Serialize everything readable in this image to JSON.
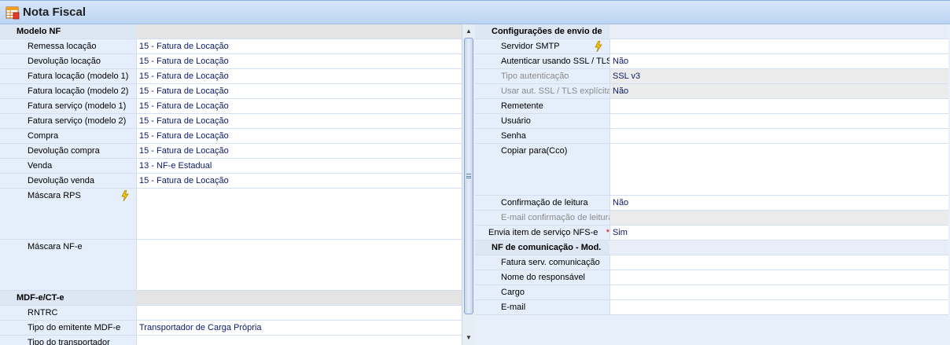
{
  "window": {
    "title": "Nota Fiscal",
    "icon": "table-form-icon"
  },
  "left": {
    "sections": {
      "modelo": {
        "title": "Modelo NF",
        "rows": [
          {
            "label": "Remessa locação",
            "value": "15 - Fatura de Locação"
          },
          {
            "label": "Devolução locação",
            "value": "15 - Fatura de Locação"
          },
          {
            "label": "Fatura locação (modelo 1)",
            "value": "15 - Fatura de Locação"
          },
          {
            "label": "Fatura locação (modelo 2)",
            "value": "15 - Fatura de Locação"
          },
          {
            "label": "Fatura serviço (modelo 1)",
            "value": "15 - Fatura de Locação"
          },
          {
            "label": "Fatura serviço (modelo 2)",
            "value": "15 - Fatura de Locação"
          },
          {
            "label": "Compra",
            "value": "15 - Fatura de Locação"
          },
          {
            "label": "Devolução compra",
            "value": "15 - Fatura de Locação"
          },
          {
            "label": "Venda",
            "value": "13 - NF-e Estadual"
          },
          {
            "label": "Devolução venda",
            "value": "15 - Fatura de Locação"
          }
        ],
        "mascara_rps": {
          "label": "Máscara RPS",
          "value": ""
        },
        "mascara_nfe": {
          "label": "Máscara NF-e",
          "value": ""
        }
      },
      "mdfe": {
        "title": "MDF-e/CT-e",
        "rows": [
          {
            "label": "RNTRC",
            "value": ""
          },
          {
            "label": "Tipo do emitente MDF-e",
            "value": "Transportador de Carga Própria"
          },
          {
            "label": "Tipo do transportador",
            "value": ""
          }
        ]
      }
    }
  },
  "right": {
    "envio": {
      "title": "Configurações de envio de",
      "servidor": {
        "label": "Servidor SMTP",
        "value": ""
      },
      "ssl": {
        "label": "Autenticar usando SSL / TLS",
        "value": "Não"
      },
      "tipo_auth": {
        "label": "Tipo autenticação",
        "value": "SSL v3"
      },
      "ssl_expl": {
        "label": "Usar aut. SSL / TLS explícita",
        "value": "Não"
      },
      "remetente": {
        "label": "Remetente",
        "value": ""
      },
      "usuario": {
        "label": "Usuário",
        "value": ""
      },
      "senha": {
        "label": "Senha",
        "value": ""
      },
      "copiar": {
        "label": "Copiar para(Cco)",
        "value": ""
      },
      "confirmacao": {
        "label": "Confirmação de leitura",
        "value": "Não"
      },
      "email_conf": {
        "label": "E-mail confirmação de leitura",
        "value": ""
      }
    },
    "envia_item": {
      "label": "Envia item de serviço NFS-e",
      "required_mark": "*",
      "value": "Sim"
    },
    "comunicacao": {
      "title": "NF de comunicação - Mod.",
      "rows": [
        {
          "label": "Fatura serv. comunicação",
          "value": ""
        },
        {
          "label": "Nome do responsável",
          "value": ""
        },
        {
          "label": "Cargo",
          "value": ""
        },
        {
          "label": "E-mail",
          "value": ""
        }
      ]
    }
  }
}
